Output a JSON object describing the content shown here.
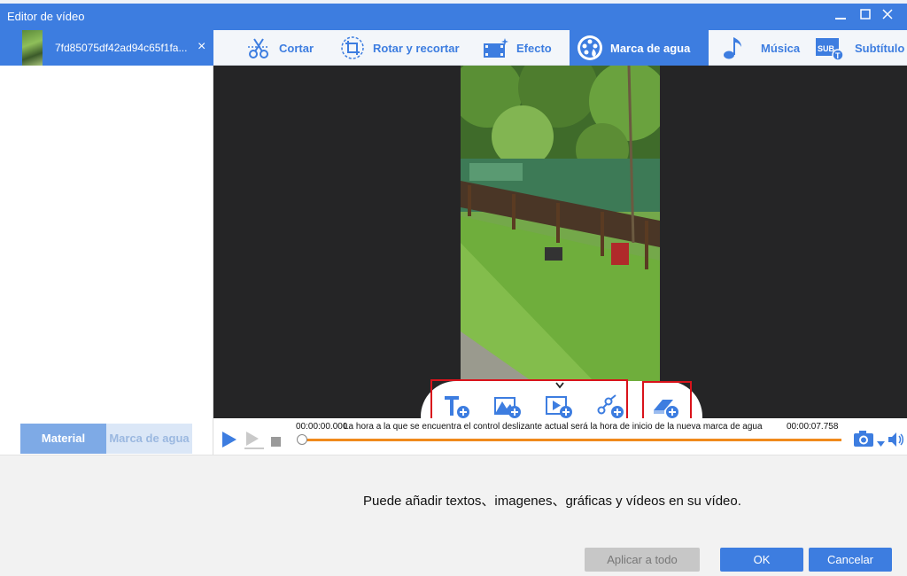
{
  "window": {
    "title": "Editor de vídeo",
    "minimize_icon": "minimize-icon",
    "maximize_icon": "maximize-icon",
    "close_icon": "close-icon"
  },
  "sidebar": {
    "file": {
      "name": "7fd85075df42ad94c65f1fa...",
      "close_label": "×"
    },
    "tabs": [
      {
        "label": "Material",
        "active": true
      },
      {
        "label": "Marca de agua",
        "active": false
      }
    ]
  },
  "toolbar": {
    "items": [
      {
        "label": "Cortar",
        "icon": "scissors-icon",
        "active": false
      },
      {
        "label": "Rotar y recortar",
        "icon": "rotate-crop-icon",
        "active": false
      },
      {
        "label": "Efecto",
        "icon": "effect-icon",
        "active": false
      },
      {
        "label": "Marca de agua",
        "icon": "watermark-icon",
        "active": true
      },
      {
        "label": "Música",
        "icon": "music-note-icon",
        "active": false
      },
      {
        "label": "Subtítulo",
        "icon": "subtitle-icon",
        "active": false
      }
    ]
  },
  "watermark_tools": [
    {
      "icon": "add-text-icon"
    },
    {
      "icon": "add-image-icon"
    },
    {
      "icon": "add-video-icon"
    },
    {
      "icon": "add-shape-icon"
    },
    {
      "icon": "add-eraser-icon"
    }
  ],
  "timeline": {
    "start_time": "00:00:00.000",
    "end_time": "00:00:07.758",
    "hint": "La hora a la que se encuentra el control deslizante actual será la hora de inicio de la nueva marca de agua",
    "progress": 0
  },
  "footer": {
    "hint": "Puede añadir textos、imagenes、gráficas y vídeos en su vídeo.",
    "apply_all": "Aplicar a todo",
    "ok": "OK",
    "cancel": "Cancelar"
  },
  "colors": {
    "accent": "#3d7de0",
    "highlight": "#d9131b",
    "progress": "#f08a1c"
  }
}
